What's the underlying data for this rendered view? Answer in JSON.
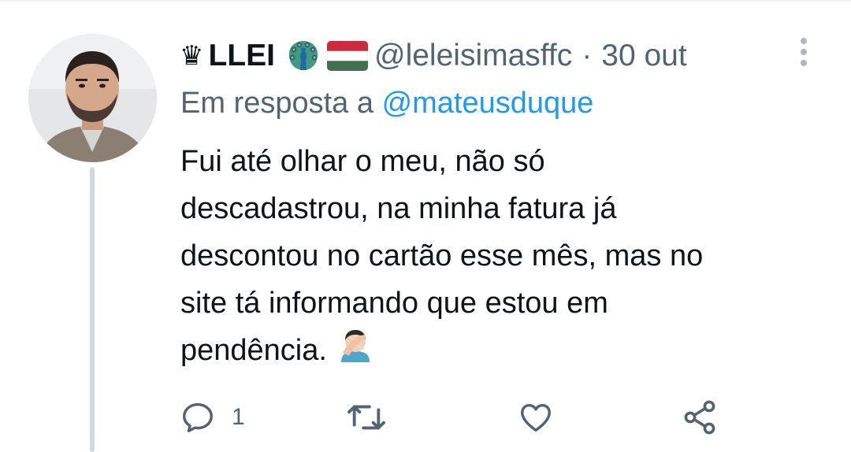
{
  "tweet": {
    "crown_glyph": "♛",
    "display_name": "LLEI",
    "emojis": [
      "peacock-emoji",
      "hungary-flag-emoji"
    ],
    "handle": "@leleisimasffc",
    "separator": "·",
    "date": "30 out",
    "reply_prefix": "Em resposta a",
    "reply_mention": "@mateusduque",
    "text": "Fui até olhar o meu, não só\ndescadastrou, na minha fatura já\ndescontou no cartão esse mês, mas no\nsite tá informando que estou em\npendência.",
    "text_end_emoji": "facepalm-emoji",
    "reply_count": "1"
  },
  "actions": {
    "reply_icon": "reply-icon",
    "retweet_icon": "retweet-icon",
    "like_icon": "heart-icon",
    "share_icon": "share-icon"
  },
  "colors": {
    "text_primary": "#0f1419",
    "text_secondary": "#536471",
    "link": "#1d9bf0",
    "thread_line": "#cfd9de",
    "icon": "#536471"
  }
}
